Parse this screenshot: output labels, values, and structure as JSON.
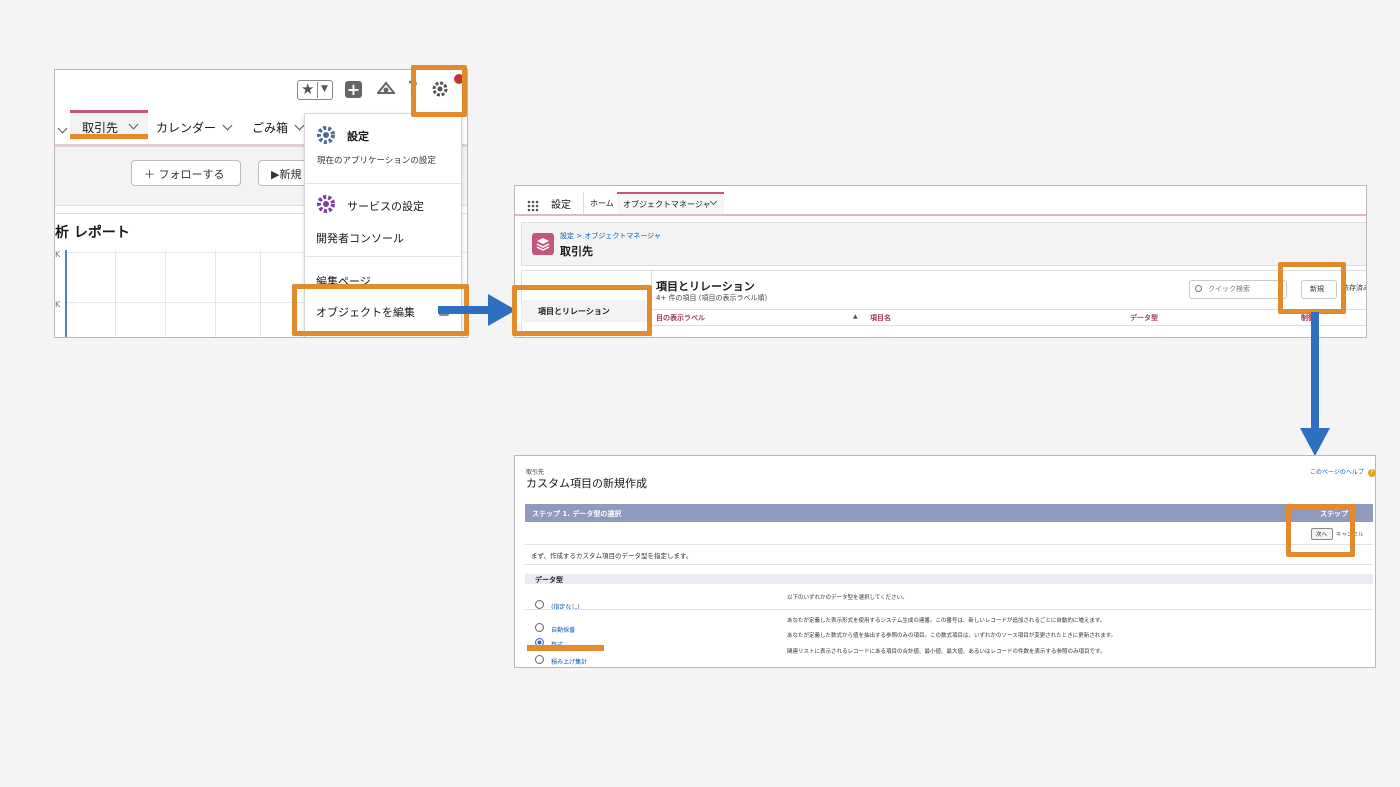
{
  "panel1": {
    "tabs": [
      {
        "label": "取引先",
        "active": true
      },
      {
        "label": "カレンダー",
        "active": false
      },
      {
        "label": "ごみ箱",
        "active": false
      }
    ],
    "follow_button": "＋ フォローする",
    "new_button": "▶新規",
    "report_title": "析 レポート",
    "axis_k1": "K",
    "axis_k2": "K",
    "menu": {
      "setup_title": "設定",
      "setup_subtitle": "現在のアプリケーションの設定",
      "service_setup": "サービスの設定",
      "dev_console": "開発者コンソール",
      "edit_page": "編集ページ",
      "edit_object": "オブジェクトを編集"
    }
  },
  "panel2": {
    "app_name": "設定",
    "tabs": [
      {
        "label": "ホーム"
      },
      {
        "label": "オブジェクトマネージャ"
      }
    ],
    "breadcrumb": "設定 > オブジェクトマネージャ",
    "object_name": "取引先",
    "sidebar_item": "項目とリレーション",
    "section_title": "項目とリレーション",
    "section_sub": "4+ 件の項目 (項目の表示ラベル順)",
    "search_placeholder": "クイック検索",
    "new_button": "新規",
    "deps_link": "依存済み",
    "columns": [
      "目の表示ラベル",
      "項目名",
      "データ型",
      "制御"
    ]
  },
  "panel3": {
    "breadcrumb": "取引先",
    "title": "カスタム項目の新規作成",
    "help_link": "このページのヘルプ",
    "step_title": "ステップ 1. データ型の選択",
    "step_counter": "ステップ 1",
    "next_button": "次へ",
    "cancel_button": "キャンセル",
    "instruction": "まず、作成するカスタム項目のデータ型を指定します。",
    "section_label": "データ型",
    "options": [
      {
        "label": "(指定なし)",
        "desc": "以下のいずれかのデータ型を選択してください。",
        "selected": false
      },
      {
        "label": "自動採番",
        "desc": "あなたが定義した表示形式を使用するシステム生成の連番。この番号は、新しいレコードが追加されるごとに自動的に増えます。",
        "selected": false
      },
      {
        "label": "数式",
        "desc": "あなたが定義した数式から値を抽出する参照のみの項目。この数式項目は、いずれかのソース項目が変更されたときに更新されます。",
        "selected": true
      },
      {
        "label": "積み上げ集計",
        "desc": "関連リストに表示されるレコードにある項目の合計値、最小値、最大値、あるいはレコードの件数を表示する参照のみ項目です。",
        "selected": false
      }
    ]
  },
  "colors": {
    "highlight": "#e38b2c",
    "arrow": "#2f6fc0",
    "accent_pink": "#c7557a",
    "link_blue": "#0b5cab",
    "step_bar": "#8e9bbd"
  },
  "icons": [
    "star-icon",
    "plus-icon",
    "trailhead-icon",
    "help-icon",
    "gear-icon",
    "app-launcher-icon",
    "layers-icon",
    "search-icon"
  ]
}
